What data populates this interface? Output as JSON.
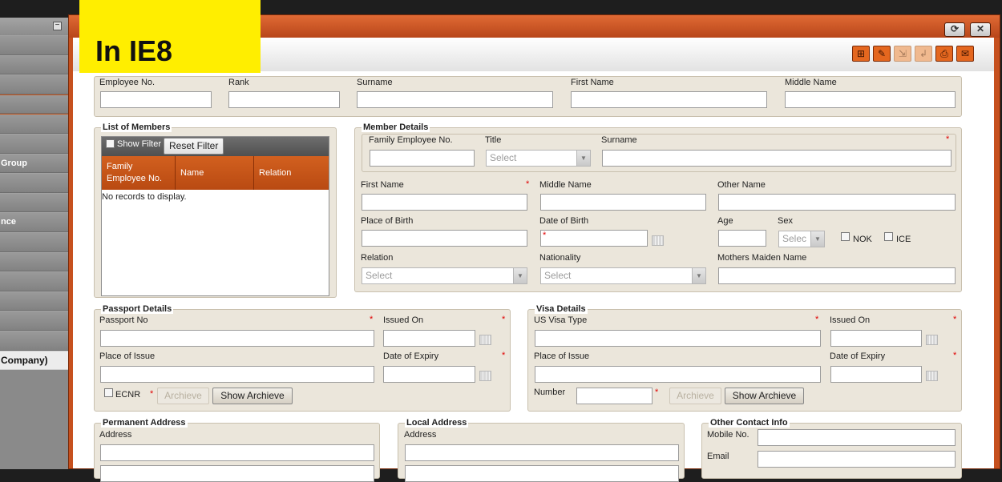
{
  "banner": {
    "text": "In IE8"
  },
  "sidebar": {
    "items": [
      {
        "label": "",
        "style": "dark"
      },
      {
        "label": "",
        "style": "dark"
      },
      {
        "label": "",
        "style": "dark"
      },
      {
        "label": "",
        "style": "rust"
      },
      {
        "label": "",
        "style": "rust"
      },
      {
        "label": "",
        "style": "dark"
      },
      {
        "label": "Group",
        "style": "dark"
      },
      {
        "label": "",
        "style": "dark"
      },
      {
        "label": "",
        "style": "dark"
      },
      {
        "label": "nce",
        "style": "dark"
      },
      {
        "label": "",
        "style": "dark"
      },
      {
        "label": "",
        "style": "dark"
      },
      {
        "label": "",
        "style": "dark"
      },
      {
        "label": "",
        "style": "dark"
      },
      {
        "label": "",
        "style": "dark"
      },
      {
        "label": "",
        "style": "dark"
      },
      {
        "label": "Company)",
        "style": "light"
      }
    ]
  },
  "window": {
    "collapse_glyph": "−",
    "refresh_glyph": "⟳",
    "close_glyph": "✕"
  },
  "toolbar": {
    "icons": [
      {
        "name": "add-icon",
        "glyph": "⊞",
        "enabled": true
      },
      {
        "name": "edit-icon",
        "glyph": "✎",
        "enabled": true
      },
      {
        "name": "save-icon",
        "glyph": "⇲",
        "enabled": false
      },
      {
        "name": "undo-icon",
        "glyph": "↲",
        "enabled": false
      },
      {
        "name": "print-icon",
        "glyph": "⎙",
        "enabled": true
      },
      {
        "name": "email-icon",
        "glyph": "✉",
        "enabled": true
      }
    ]
  },
  "employee": {
    "employee_no": "Employee No.",
    "rank": "Rank",
    "surname": "Surname",
    "first_name": "First Name",
    "middle_name": "Middle Name"
  },
  "members": {
    "legend": "List of Members",
    "show_filter": "Show Filter",
    "reset_filter": "Reset Filter",
    "columns": [
      "Family Employee No.",
      "Name",
      "Relation"
    ],
    "empty_text": "No records to display."
  },
  "member_details": {
    "legend": "Member Details",
    "family_employee_no": "Family Employee No.",
    "title": "Title",
    "title_placeholder": "Select",
    "surname": "Surname",
    "first_name": "First Name",
    "middle_name": "Middle Name",
    "other_name": "Other Name",
    "place_of_birth": "Place of Birth",
    "date_of_birth": "Date of Birth",
    "age": "Age",
    "sex": "Sex",
    "sex_placeholder": "Selec",
    "nok": "NOK",
    "ice": "ICE",
    "relation": "Relation",
    "relation_placeholder": "Select",
    "nationality": "Nationality",
    "nationality_placeholder": "Select",
    "mothers_maiden_name": "Mothers Maiden Name"
  },
  "passport": {
    "legend": "Passport Details",
    "passport_no": "Passport No",
    "issued_on": "Issued On",
    "place_of_issue": "Place of Issue",
    "date_of_expiry": "Date of Expiry",
    "ecnr": "ECNR",
    "archive": "Archieve",
    "show_archive": "Show Archieve"
  },
  "visa": {
    "legend": "Visa Details",
    "us_visa_type": "US Visa Type",
    "issued_on": "Issued On",
    "place_of_issue": "Place of Issue",
    "date_of_expiry": "Date of Expiry",
    "number": "Number",
    "archive": "Archieve",
    "show_archive": "Show Archieve"
  },
  "permanent_address": {
    "legend": "Permanent Address",
    "address": "Address"
  },
  "local_address": {
    "legend": "Local Address",
    "address": "Address"
  },
  "other_contact": {
    "legend": "Other Contact Info",
    "mobile_no": "Mobile No.",
    "email": "Email"
  },
  "required_mark": "*"
}
